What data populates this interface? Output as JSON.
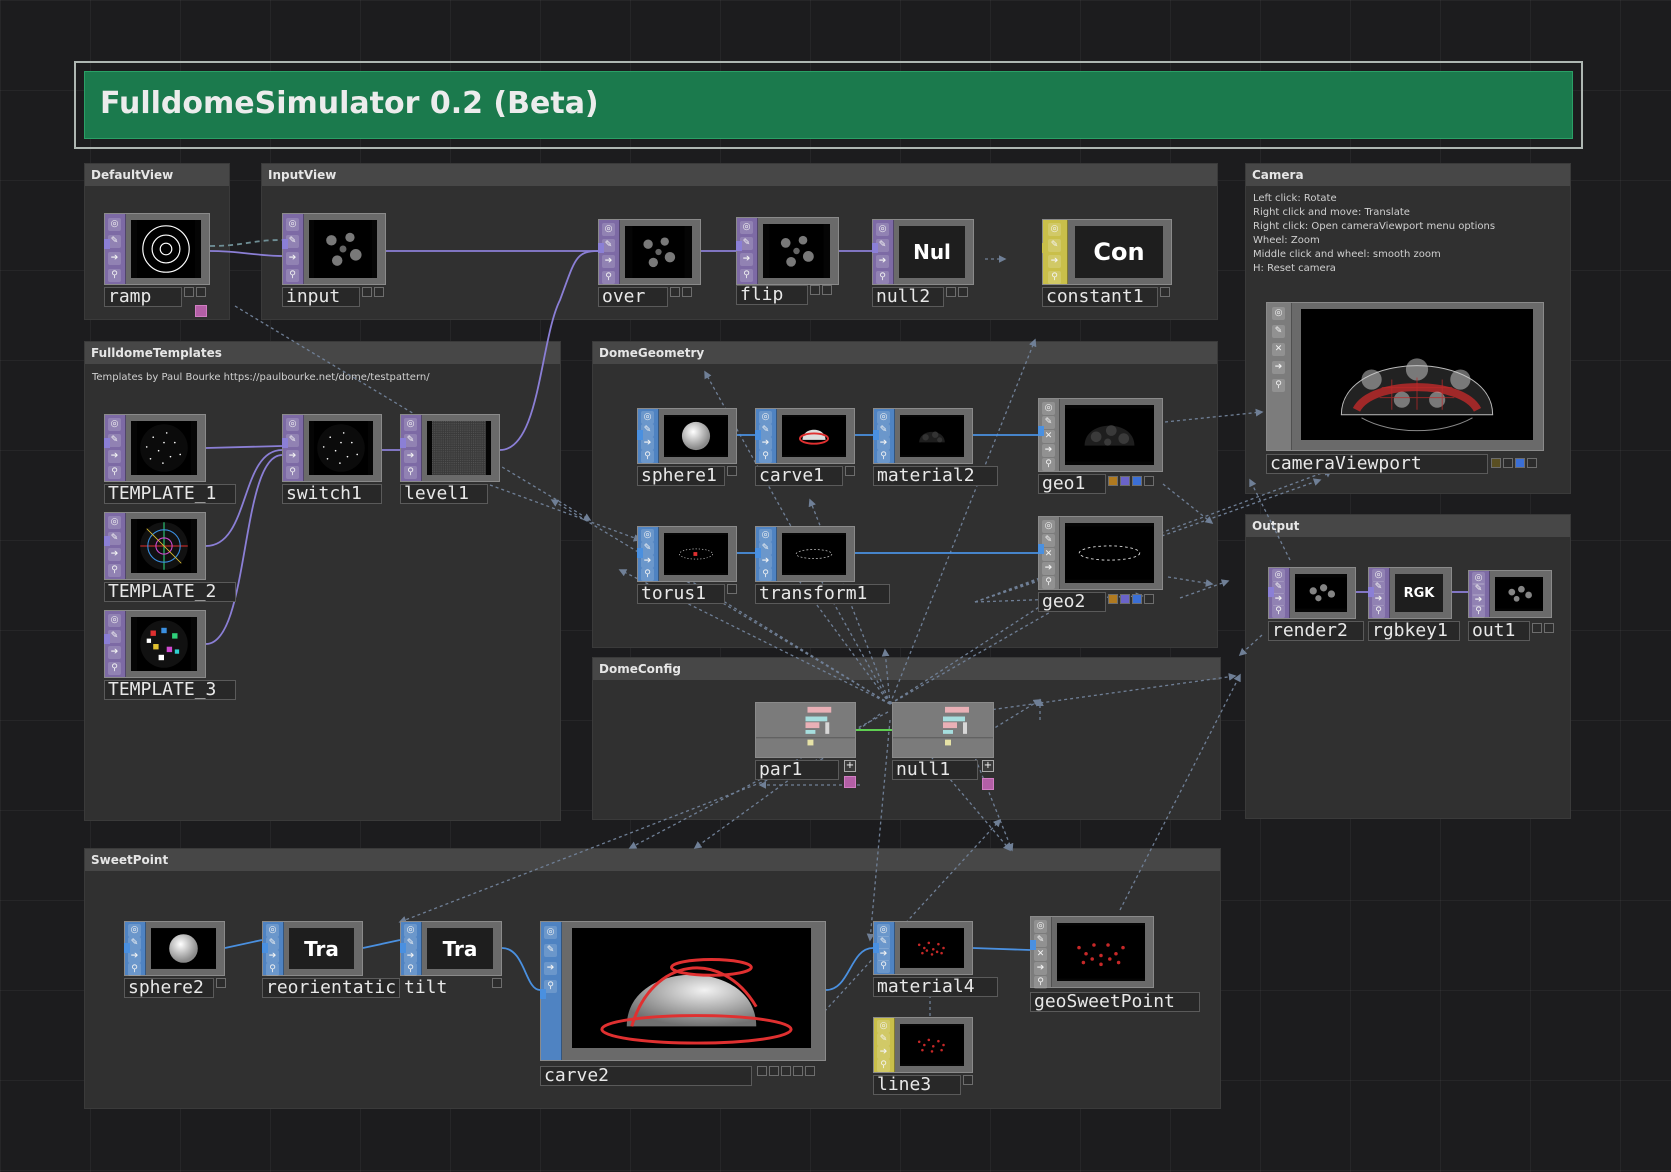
{
  "window": {
    "title": "FulldomeSimulator 0.2 (Beta)"
  },
  "colors": {
    "background": "#1c1c1e",
    "title_bar": "#1b7a4d",
    "annotation_body": "#303030",
    "annotation_header": "#474747",
    "top_operator": "#7d6aa5",
    "sop_operator": "#4f83c2",
    "mat_operator": "#c9bf4a",
    "comp_operator": "#7c7c7c",
    "wire_top": "#8b7fd6",
    "wire_sop": "#4a90e0",
    "wire_chop": "#5fcf52",
    "wire_reference": "#6f7f96",
    "highlight_red": "#e03030"
  },
  "annotations": [
    {
      "title": "DefaultView"
    },
    {
      "title": "InputView"
    },
    {
      "title": "Camera",
      "notes": [
        "Left click: Rotate",
        "Right click and move: Translate",
        "Right click: Open cameraViewport menu options",
        "Wheel: Zoom",
        "Middle click and wheel: smooth zoom",
        "H: Reset camera"
      ]
    },
    {
      "title": "FulldomeTemplates",
      "note": "Templates by Paul Bourke https://paulbourke.net/dome/testpattern/"
    },
    {
      "title": "DomeGeometry"
    },
    {
      "title": "Output"
    },
    {
      "title": "DomeConfig"
    },
    {
      "title": "SweetPoint"
    }
  ],
  "nodes": {
    "ramp": {
      "label": "ramp",
      "family": "TOP",
      "icon": "ramp-rings-icon"
    },
    "input": {
      "label": "input",
      "family": "TOP",
      "icon": "dome-dots-icon"
    },
    "over": {
      "label": "over",
      "family": "TOP",
      "icon": "dome-dots-icon"
    },
    "flip": {
      "label": "flip",
      "family": "TOP",
      "icon": "dome-dots-icon"
    },
    "null2": {
      "label": "null2",
      "family": "TOP",
      "thumb_text": "Nul"
    },
    "constant1": {
      "label": "constant1",
      "family": "MAT",
      "thumb_text": "Con"
    },
    "cameraViewport": {
      "label": "cameraViewport",
      "family": "COMP",
      "icon": "dome-render-icon"
    },
    "TEMPLATE_1": {
      "label": "TEMPLATE_1",
      "family": "TOP",
      "icon": "starfield-icon"
    },
    "TEMPLATE_2": {
      "label": "TEMPLATE_2",
      "family": "TOP",
      "icon": "color-grid-icon"
    },
    "TEMPLATE_3": {
      "label": "TEMPLATE_3",
      "family": "TOP",
      "icon": "color-tiles-icon"
    },
    "switch1": {
      "label": "switch1",
      "family": "TOP",
      "icon": "starfield-icon"
    },
    "level1": {
      "label": "level1",
      "family": "TOP",
      "icon": "noise-icon"
    },
    "sphere1": {
      "label": "sphere1",
      "family": "SOP",
      "icon": "sphere-icon"
    },
    "carve1": {
      "label": "carve1",
      "family": "SOP",
      "icon": "carve-icon"
    },
    "material2": {
      "label": "material2",
      "family": "SOP",
      "icon": "dark-dome-icon"
    },
    "geo1": {
      "label": "geo1",
      "family": "COMP",
      "icon": "dark-dome-icon"
    },
    "torus1": {
      "label": "torus1",
      "family": "SOP",
      "icon": "torus-icon"
    },
    "transform1": {
      "label": "transform1",
      "family": "SOP",
      "icon": "ring-icon"
    },
    "geo2": {
      "label": "geo2",
      "family": "COMP",
      "icon": "ring-icon"
    },
    "render2": {
      "label": "render2",
      "family": "TOP",
      "icon": "dome-dots-icon"
    },
    "rgbkey1": {
      "label": "rgbkey1",
      "family": "TOP",
      "thumb_text": "RGK"
    },
    "out1": {
      "label": "out1",
      "family": "TOP",
      "icon": "dome-dots-icon"
    },
    "par1": {
      "label": "par1",
      "family": "CHOP",
      "icon": "channel-bars-icon"
    },
    "null1": {
      "label": "null1",
      "family": "CHOP",
      "icon": "channel-bars-icon"
    },
    "sphere2": {
      "label": "sphere2",
      "family": "SOP",
      "icon": "sphere-icon"
    },
    "reorientation": {
      "label": "reorientatic",
      "family": "SOP",
      "thumb_text": "Tra"
    },
    "tilt": {
      "label": "tilt",
      "family": "SOP",
      "thumb_text": "Tra"
    },
    "carve2": {
      "label": "carve2",
      "family": "SOP",
      "icon": "sweet-dome-icon"
    },
    "material4": {
      "label": "material4",
      "family": "SOP",
      "icon": "red-dots-icon"
    },
    "geoSweetPoint": {
      "label": "geoSweetPoint",
      "family": "COMP",
      "icon": "red-dots-icon"
    },
    "line3": {
      "label": "line3",
      "family": "MAT",
      "icon": "red-dots-icon"
    }
  }
}
